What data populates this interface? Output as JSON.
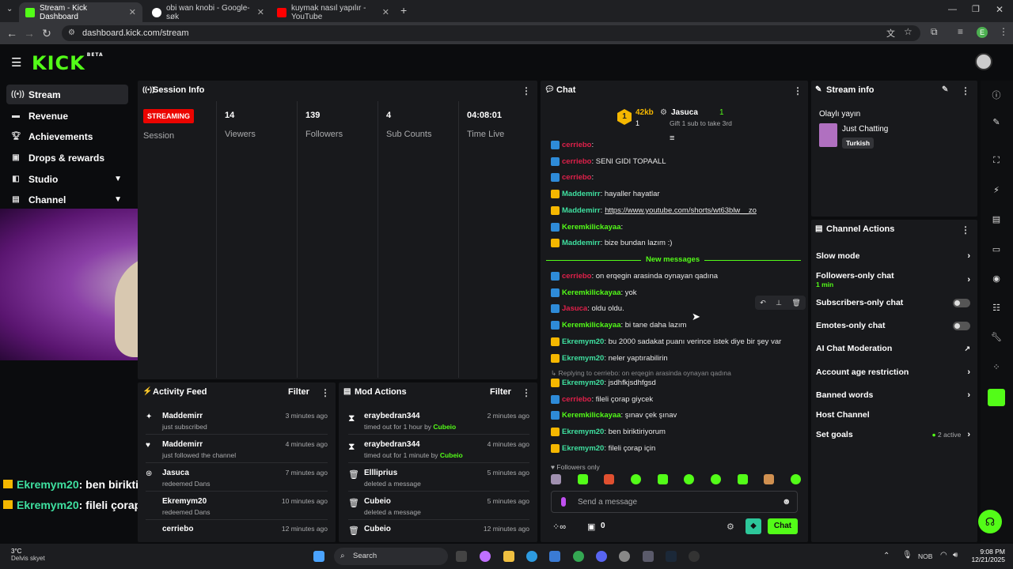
{
  "browser": {
    "tabs": [
      {
        "label": "Stream - Kick Dashboard",
        "active": true
      },
      {
        "label": "obi wan knobi - Google-søk",
        "active": false
      },
      {
        "label": "kuymak nasıl yapılır - YouTube",
        "active": false
      }
    ],
    "url": "dashboard.kick.com/stream",
    "profile_initial": "E"
  },
  "header": {
    "logo": "KICK",
    "logo_tag": "BETA"
  },
  "sidebar": {
    "items": [
      {
        "label": "Stream",
        "icon": "broadcast-icon"
      },
      {
        "label": "Revenue",
        "icon": "money-icon"
      },
      {
        "label": "Achievements",
        "icon": "trophy-icon"
      },
      {
        "label": "Drops & rewards",
        "icon": "gift-icon"
      },
      {
        "label": "Studio",
        "icon": "studio-icon"
      },
      {
        "label": "Channel",
        "icon": "channel-icon"
      }
    ]
  },
  "session": {
    "title": "Session Info",
    "status": "STREAMING",
    "status_label": "Session",
    "stats": [
      {
        "value": "14",
        "label": "Viewers"
      },
      {
        "value": "139",
        "label": "Followers"
      },
      {
        "value": "4",
        "label": "Sub Counts"
      },
      {
        "value": "04:08:01",
        "label": "Time Live"
      }
    ]
  },
  "overlay": {
    "lines": [
      {
        "user": "Ekremym20",
        "text": ": ben biriktiriyorum"
      },
      {
        "user": "Ekremym20",
        "text": ": fileli çorap için"
      }
    ]
  },
  "activity": {
    "title": "Activity Feed",
    "filter": "Filter",
    "items": [
      {
        "name": "Maddemirr",
        "sub": "just subscribed",
        "time": "3 minutes ago"
      },
      {
        "name": "Maddemirr",
        "sub": "just followed the channel",
        "time": "4 minutes ago"
      },
      {
        "name": "Jasuca",
        "sub": "redeemed Dans",
        "time": "7 minutes ago"
      },
      {
        "name": "Ekremym20",
        "sub": "redeemed Dans",
        "time": "10 minutes ago"
      },
      {
        "name": "cerriebo",
        "sub": "",
        "time": "12 minutes ago"
      }
    ]
  },
  "mod": {
    "title": "Mod Actions",
    "filter": "Filter",
    "items": [
      {
        "name": "eraybedran344",
        "sub": "timed out for 1 hour by",
        "by": "Cubeio",
        "time": "2 minutes ago"
      },
      {
        "name": "eraybedran344",
        "sub": "timed out for 1 minute by",
        "by": "Cubeio",
        "time": "4 minutes ago"
      },
      {
        "name": "Ellliprius",
        "sub": "deleted a message",
        "by": "",
        "time": "5 minutes ago"
      },
      {
        "name": "Cubeio",
        "sub": "deleted a message",
        "by": "",
        "time": "5 minutes ago"
      },
      {
        "name": "Cubeio",
        "sub": "",
        "by": "",
        "time": "12 minutes ago"
      }
    ]
  },
  "chat": {
    "title": "Chat",
    "gift": {
      "amount": "42kb",
      "count": "1",
      "rank": "1",
      "user": "Jasuca",
      "user_count": "1",
      "note": "Gift 1 sub to take 3rd"
    },
    "messages": [
      {
        "user": "cerriebo",
        "cls": "red",
        "text": ":"
      },
      {
        "user": "cerriebo",
        "cls": "red",
        "text": ": SENI GIDI TOPAALL"
      },
      {
        "user": "cerriebo",
        "cls": "red",
        "text": ":"
      },
      {
        "user": "Maddemirr",
        "cls": "teal",
        "text": ": hayaller hayatlar"
      },
      {
        "user": "Maddemirr",
        "cls": "teal",
        "text": ":",
        "link": "https://www.youtube.com/shorts/wt63blw__zo"
      },
      {
        "user": "Keremkilickayaa",
        "cls": "green",
        "text": ":"
      },
      {
        "user": "Maddemirr",
        "cls": "teal",
        "text": ": bize bundan lazım :)"
      }
    ],
    "new_messages": "New messages",
    "messages2": [
      {
        "user": "cerriebo",
        "cls": "red",
        "text": ": on erqegin arasinda oynayan qadına"
      },
      {
        "user": "Keremkilickayaa",
        "cls": "green",
        "text": ": yok"
      },
      {
        "user": "Jasuca",
        "cls": "red",
        "text": ": oldu oldu."
      },
      {
        "user": "Keremkilickayaa",
        "cls": "green",
        "text": ": bi tane daha lazım"
      },
      {
        "user": "Ekremym20",
        "cls": "teal",
        "text": ": bu 2000 sadakat puanı verince istek diye bir şey var"
      },
      {
        "user": "Ekremym20",
        "cls": "teal",
        "text": ": neler yaptırabilirin"
      }
    ],
    "reply_note": "Replying to cerriebo: on erqegin arasinda oynayan qadına",
    "messages3": [
      {
        "user": "Ekremym20",
        "cls": "teal",
        "text": ": jsdhfkjsdhfgsd"
      },
      {
        "user": "cerriebo",
        "cls": "red",
        "text": ": fileli çorap giycek"
      },
      {
        "user": "Keremkilickayaa",
        "cls": "green",
        "text": ": şınav çek şınav"
      },
      {
        "user": "Ekremym20",
        "cls": "teal",
        "text": ": ben biriktiriyorum"
      },
      {
        "user": "Ekremym20",
        "cls": "teal",
        "text": ": fileli çorap için"
      }
    ],
    "followers_only": "Followers only",
    "input_placeholder": "Send a message",
    "points": "0",
    "send": "Chat"
  },
  "stream_info": {
    "title": "Stream info",
    "stream_title": "Olaylı yayın",
    "category": "Just Chatting",
    "tag": "Turkish"
  },
  "channel_actions": {
    "title": "Channel Actions",
    "rows": [
      {
        "label": "Slow mode",
        "type": "chevron",
        "sub": ""
      },
      {
        "label": "Followers-only chat",
        "type": "chevron",
        "sub": "1 min"
      },
      {
        "label": "Subscribers-only chat",
        "type": "toggle",
        "sub": ""
      },
      {
        "label": "Emotes-only chat",
        "type": "toggle",
        "sub": ""
      },
      {
        "label": "AI Chat Moderation",
        "type": "external",
        "sub": ""
      },
      {
        "label": "Account age restriction",
        "type": "chevron",
        "sub": ""
      },
      {
        "label": "Banned words",
        "type": "chevron",
        "sub": ""
      },
      {
        "label": "Host Channel",
        "type": "none",
        "sub": ""
      },
      {
        "label": "Set goals",
        "type": "chevron",
        "sub": "",
        "extra": "2 active"
      }
    ]
  },
  "taskbar": {
    "weather_temp": "3°C",
    "weather_desc": "Delvis skyet",
    "search": "Search",
    "lang": "NOB",
    "time": "9:08 PM",
    "date": "12/21/2025"
  },
  "colors": {
    "brand": "#53fc18",
    "bg": "#0b0c0e",
    "panel": "#18191c",
    "streaming": "#eb0400"
  }
}
